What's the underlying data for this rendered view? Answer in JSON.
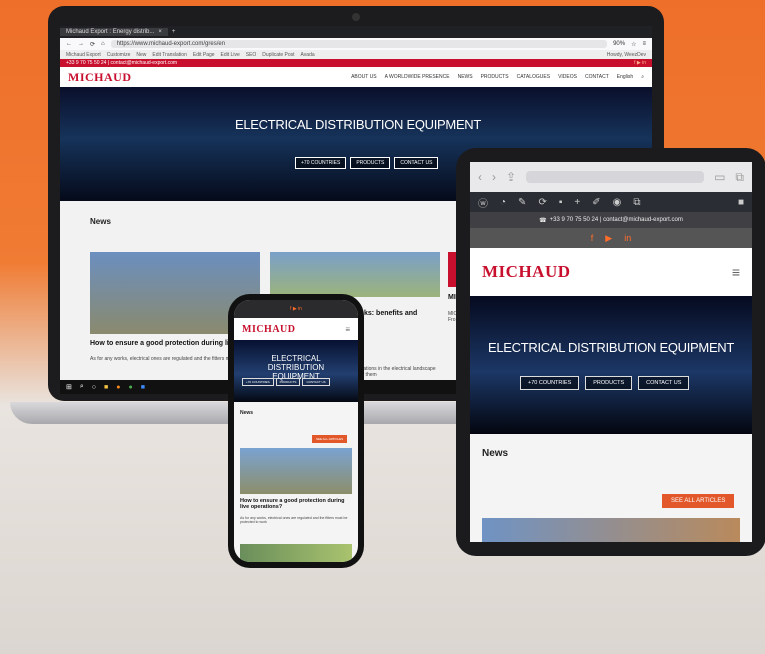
{
  "browser": {
    "tab_title": "Michaud Export : Energy distrib...",
    "new_tab": "+",
    "url": "https://www.michaud-export.com/gres/en",
    "zoom": "90%",
    "bookmarks": [
      "Michaud Export",
      "Customize",
      "New",
      "Edit Translation",
      "Edit Page",
      "Edit Live",
      "SEO",
      "Duplicate Post",
      "Avada"
    ],
    "greeting": "Howdy, WeezDev"
  },
  "site": {
    "contact_line": "+33 9 70 75 50 24 | contact@michaud-export.com",
    "logo": "MICHAUD",
    "nav": [
      "ABOUT US",
      "A WORLDWIDE PRESENCE",
      "NEWS",
      "PRODUCTS",
      "CATALOGUES",
      "VIDEOS",
      "CONTACT",
      "English"
    ],
    "hero_title": "ELECTRICAL DISTRIBUTION EQUIPMENT",
    "hero_buttons": [
      "+70 COUNTRIES",
      "PRODUCTS",
      "CONTACT US"
    ],
    "news_heading": "News",
    "see_all": "SEE ALL ARTICLES",
    "article1_title": "How to ensure a good protection during live ope",
    "article1_text": "As for any works, electrical ones are regulated and the fitters must be p work",
    "article2_title": "ks: benefits and",
    "article2_text": "illations in the electrical landscape of them",
    "article3_title": "MI",
    "article3_text": "MIC Fro"
  },
  "phone": {
    "hero_title": "ELECTRICAL DISTRIBUTION EQUIPMENT",
    "hero_buttons": [
      "+70 COUNTRIES",
      "PRODUCTS",
      "CONTACT US"
    ],
    "article_title": "How to ensure a good protection during live operations?",
    "article_text": "As for any works, electrical ones are regulated and the fitters must be protected to work"
  },
  "tablet": {
    "contact": "+33 9 70 75 50 24 | contact@michaud-export.com",
    "social": [
      "f",
      "▶",
      "in"
    ]
  },
  "colors": {
    "accent": "#c8102e",
    "orange": "#e2582a",
    "background": "#ee6f2a"
  }
}
